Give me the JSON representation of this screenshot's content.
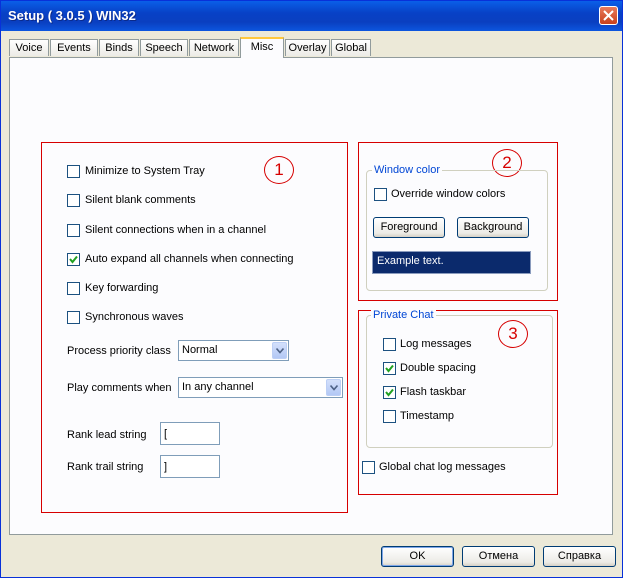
{
  "window": {
    "title": "Setup ( 3.0.5 ) WIN32"
  },
  "tabs": [
    {
      "label": "Voice"
    },
    {
      "label": "Events"
    },
    {
      "label": "Binds"
    },
    {
      "label": "Speech"
    },
    {
      "label": "Network"
    },
    {
      "label": "Misc"
    },
    {
      "label": "Overlay"
    },
    {
      "label": "Global"
    }
  ],
  "active_tab": "Misc",
  "annotations": {
    "one": "1",
    "two": "2",
    "three": "3"
  },
  "misc": {
    "checkboxes": [
      {
        "label": "Minimize to System Tray",
        "checked": false
      },
      {
        "label": "Silent blank comments",
        "checked": false
      },
      {
        "label": "Silent connections when in a channel",
        "checked": false
      },
      {
        "label": "Auto expand all channels when connecting",
        "checked": true
      },
      {
        "label": "Key forwarding",
        "checked": false
      },
      {
        "label": "Synchronous waves",
        "checked": false
      }
    ],
    "process_priority": {
      "label": "Process priority class",
      "value": "Normal"
    },
    "play_comments": {
      "label": "Play comments when",
      "value": "In any channel"
    },
    "rank_lead": {
      "label": "Rank lead string",
      "value": "["
    },
    "rank_trail": {
      "label": "Rank trail string",
      "value": "]"
    }
  },
  "window_color": {
    "group_title": "Window color",
    "override_label": "Override window colors",
    "override_checked": false,
    "foreground_label": "Foreground",
    "background_label": "Background",
    "example_text": "Example text.",
    "example_bg": "#0b2a6c"
  },
  "private_chat": {
    "group_title": "Private Chat",
    "items": [
      {
        "label": "Log messages",
        "checked": false
      },
      {
        "label": "Double spacing",
        "checked": true
      },
      {
        "label": "Flash taskbar",
        "checked": true
      },
      {
        "label": "Timestamp",
        "checked": false
      }
    ],
    "global_log_label": "Global chat log messages",
    "global_log_checked": false
  },
  "buttons": {
    "ok": "OK",
    "cancel": "Отмена",
    "help": "Справка"
  },
  "colors": {
    "title_bar": "#0a3fc0",
    "annotation_red": "#d60000",
    "check_green": "#21a121"
  }
}
